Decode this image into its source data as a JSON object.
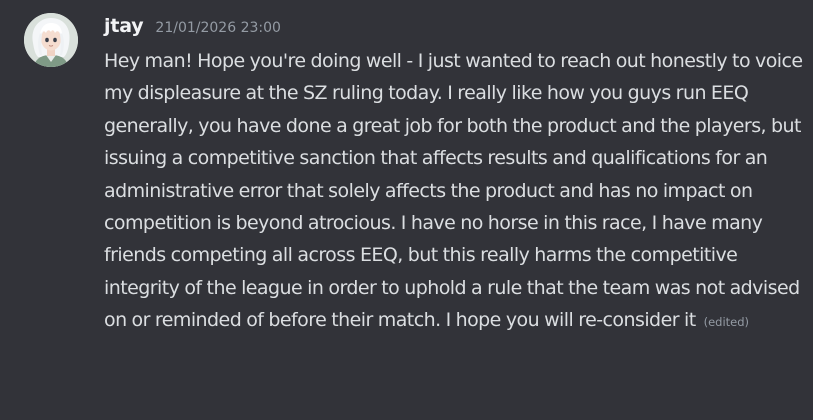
{
  "message": {
    "author": "jtay",
    "timestamp": "21/01/2026 23:00",
    "content": "Hey man! Hope you're doing well - I just wanted to reach out honestly to voice my displeasure at the SZ ruling today. I really like how you guys run EEQ generally, you have done a great job for both the product and the players, but issuing a competitive sanction that affects results and qualifications for an administrative error that solely affects the product and has no impact on competition is beyond atrocious. I have no horse in this race, I have many friends competing all across EEQ, but this really harms the competitive integrity of the league in order to uphold a rule that the team was not advised on or reminded of before their match. I hope you will re-consider it",
    "edited_label": "(edited)"
  }
}
